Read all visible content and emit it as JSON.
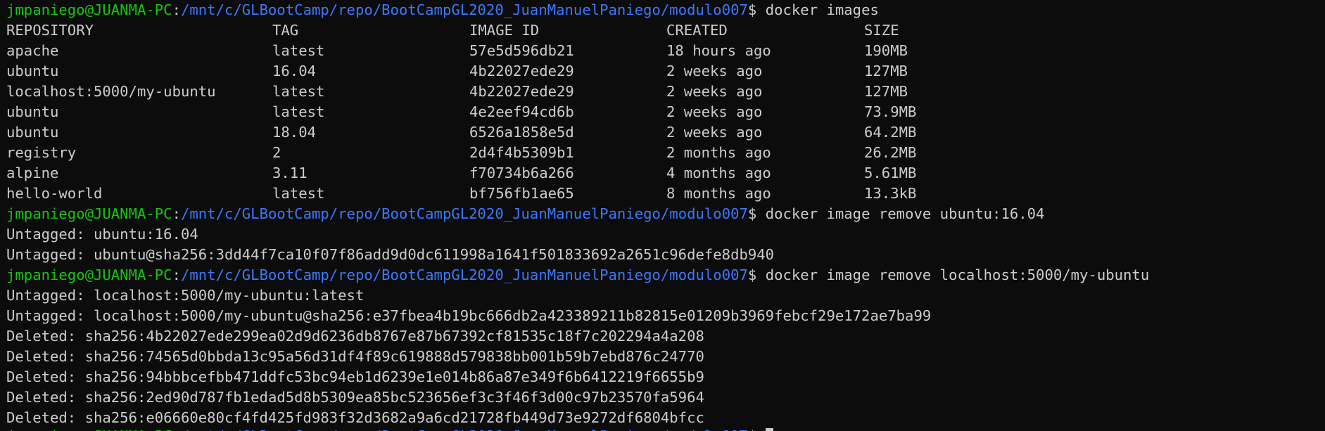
{
  "prompt": {
    "user": "jmpaniego@JUANMA-PC",
    "colon": ":",
    "path": "/mnt/c/GLBootCamp/repo/BootCampGL2020_JuanManuelPaniego/modulo007",
    "dollar": "$"
  },
  "commands": {
    "cmd1": " docker images",
    "cmd2": " docker image remove ubuntu:16.04",
    "cmd3": " docker image remove localhost:5000/my-ubuntu"
  },
  "images_table": {
    "headers": [
      "REPOSITORY",
      "TAG",
      "IMAGE ID",
      "CREATED",
      "SIZE"
    ],
    "rows": [
      [
        "apache",
        "latest",
        "57e5d596db21",
        "18 hours ago",
        "190MB"
      ],
      [
        "ubuntu",
        "16.04",
        "4b22027ede29",
        "2 weeks ago",
        "127MB"
      ],
      [
        "localhost:5000/my-ubuntu",
        "latest",
        "4b22027ede29",
        "2 weeks ago",
        "127MB"
      ],
      [
        "ubuntu",
        "latest",
        "4e2eef94cd6b",
        "2 weeks ago",
        "73.9MB"
      ],
      [
        "ubuntu",
        "18.04",
        "6526a1858e5d",
        "2 weeks ago",
        "64.2MB"
      ],
      [
        "registry",
        "2",
        "2d4f4b5309b1",
        "2 months ago",
        "26.2MB"
      ],
      [
        "alpine",
        "3.11",
        "f70734b6a266",
        "4 months ago",
        "5.61MB"
      ],
      [
        "hello-world",
        "latest",
        "bf756fb1ae65",
        "8 months ago",
        "13.3kB"
      ]
    ]
  },
  "output2": [
    "Untagged: ubuntu:16.04",
    "Untagged: ubuntu@sha256:3dd44f7ca10f07f86add9d0dc611998a1641f501833692a2651c96defe8db940"
  ],
  "output3": [
    "Untagged: localhost:5000/my-ubuntu:latest",
    "Untagged: localhost:5000/my-ubuntu@sha256:e37fbea4b19bc666db2a423389211b82815e01209b3969febcf29e172ae7ba99",
    "Deleted: sha256:4b22027ede299ea02d9d6236db8767e87b67392cf81535c18f7c202294a4a208",
    "Deleted: sha256:74565d0bbda13c95a56d31df4f89c619888d579838bb001b59b7ebd876c24770",
    "Deleted: sha256:94bbbcefbb471ddfc53bc94eb1d6239e1e014b86a87e349f6b6412219f6655b9",
    "Deleted: sha256:2ed90d787fb1edad5d8b5309ea85bc523656ef3c3f46f3d00c97b23570fa5964",
    "Deleted: sha256:e06660e80cf4fd425fd983f32d3682a9a6cd21728fb449d73e9272df6804bfcc"
  ],
  "colors": {
    "background": "#0c0c0c",
    "text": "#cccccc",
    "user": "#16c60c",
    "path": "#3b78ff"
  }
}
